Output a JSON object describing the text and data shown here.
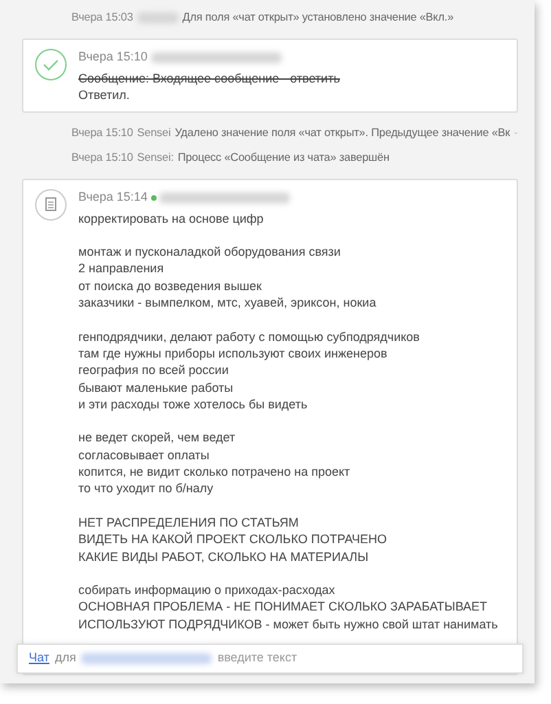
{
  "feed": [
    {
      "kind": "log",
      "time": "Вчера 15:03",
      "author_blurred": true,
      "text": "Для поля «чат открыт» установлено значение «Вкл.»"
    },
    {
      "kind": "task",
      "time": "Вчера 15:10",
      "author_blurred": true,
      "completed": true,
      "title": "Сообщение: Входящее сообщение - ответить",
      "result": "Ответил."
    },
    {
      "kind": "log",
      "time": "Вчера 15:10",
      "author": "Sensei",
      "text": "Удалено значение поля «чат открыт». Предыдущее значение «Вк",
      "expandable": true
    },
    {
      "kind": "log",
      "time": "Вчера 15:10",
      "author": "Sensei:",
      "text": "Процесс «Сообщение из чата» завершён"
    },
    {
      "kind": "message",
      "time": "Вчера 15:14",
      "online": true,
      "author_blurred": true,
      "paragraphs": [
        [
          "корректировать на основе цифр"
        ],
        [
          "монтаж и пусконаладкой оборудования связи",
          "2 направления",
          "от поиска до возведения вышек",
          "заказчики - вымпелком, мтс, хуавей, эриксон, нокиа"
        ],
        [
          "генподрядчики, делают работу с помощью субподрядчиков",
          "там где нужны приборы используют своих инженеров",
          "география по всей россии",
          "бывают маленькие работы",
          "и эти расходы тоже хотелось бы видеть"
        ],
        [
          "не ведет скорей, чем ведет",
          "согласовывает оплаты",
          "копится, не видит сколько потрачено на проект",
          "то что уходит по б/налу"
        ],
        [
          "НЕТ РАСПРЕДЕЛЕНИЯ ПО СТАТЬЯМ",
          "ВИДЕТЬ НА КАКОЙ ПРОЕКТ СКОЛЬКО ПОТРАЧЕНО",
          "КАКИЕ ВИДЫ РАБОТ, СКОЛЬКО НА МАТЕРИАЛЫ"
        ],
        [
          "собирать информацию о приходах-расходах",
          "ОСНОВНАЯ ПРОБЛЕМА - НЕ ПОНИМАЕТ СКОЛЬКО ЗАРАБАТЫВАЕТ",
          "ИСПОЛЬЗУЮТ ПОДРЯДЧИКОВ - может быть нужно свой штат нанимать"
        ]
      ]
    }
  ],
  "chat_bar": {
    "link": "Чат",
    "for": "для",
    "recipient_blurred": true,
    "placeholder": "введите текст"
  }
}
